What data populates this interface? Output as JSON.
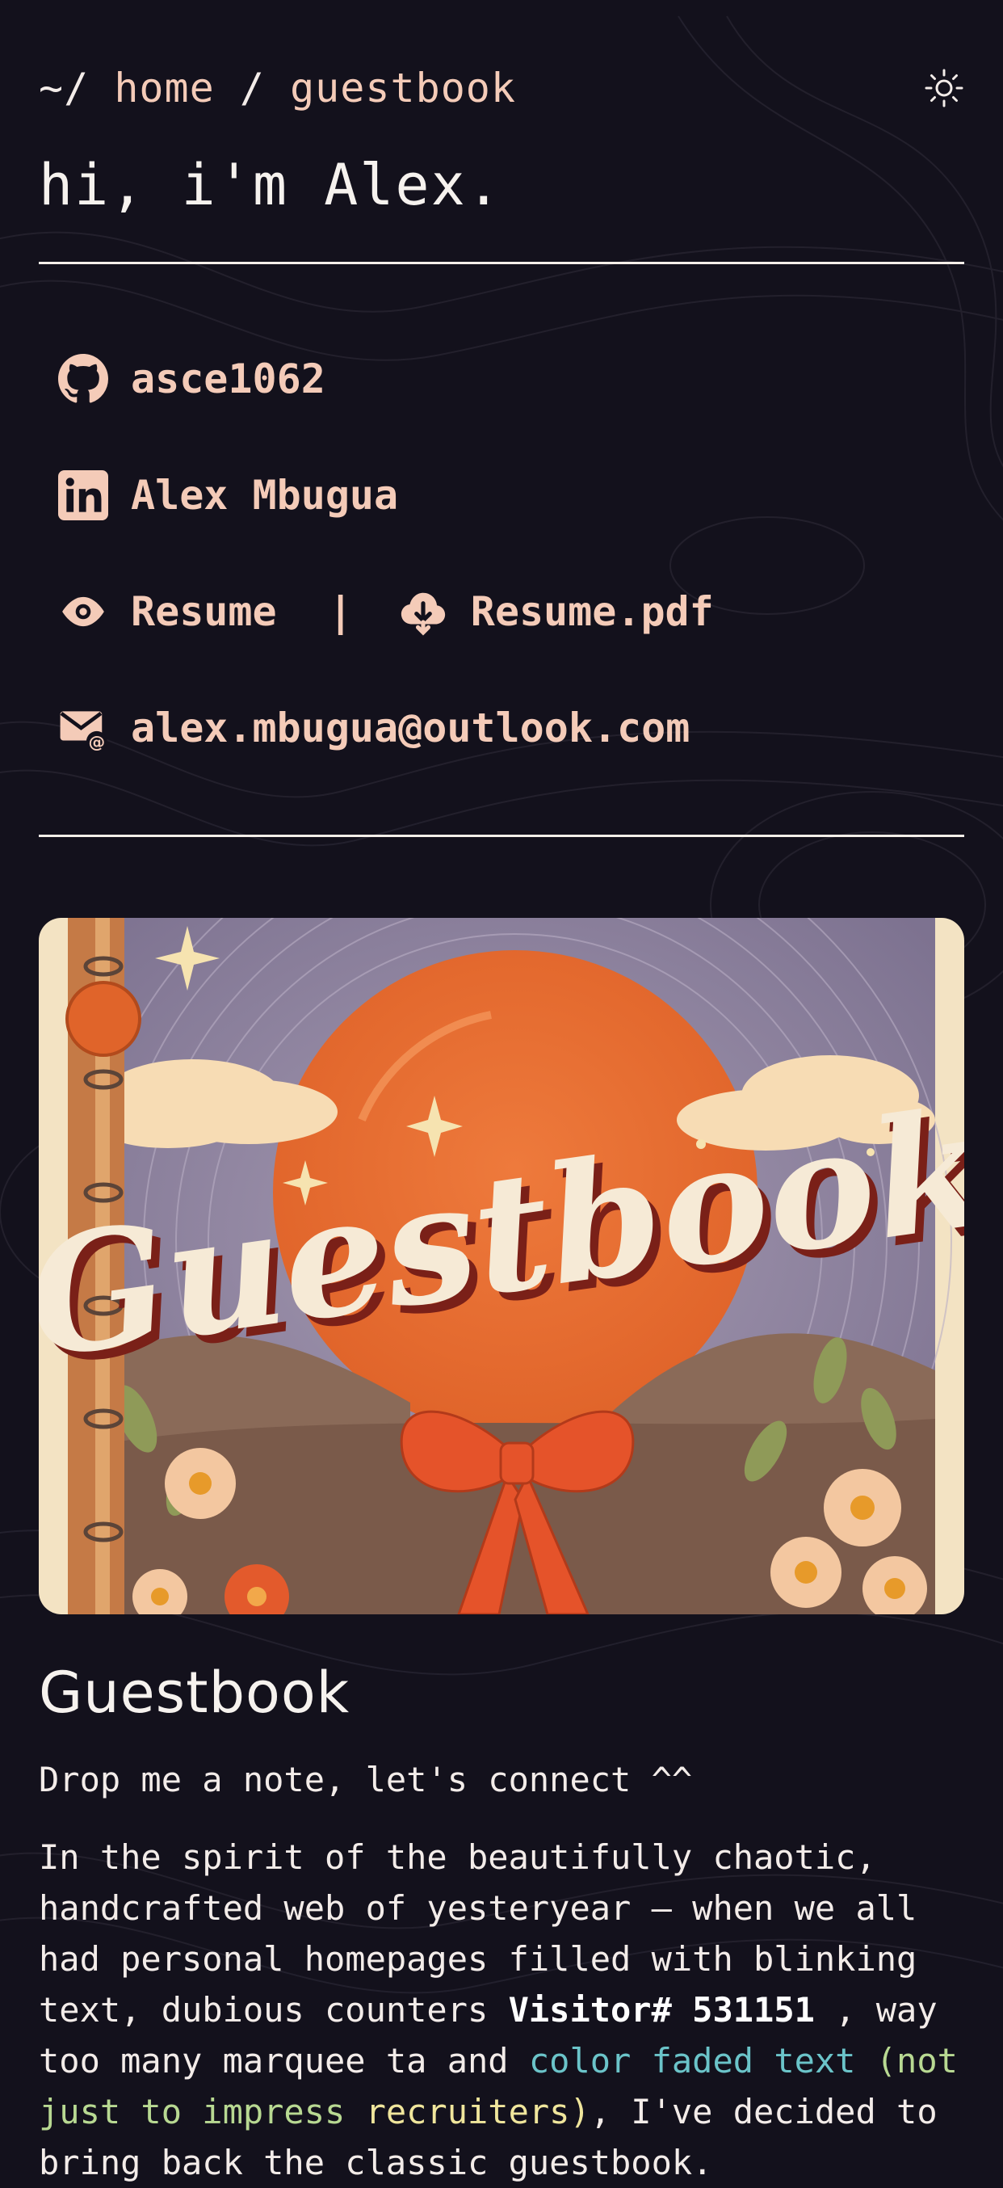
{
  "header": {
    "breadcrumb_root": "~/",
    "breadcrumb_home": "home",
    "breadcrumb_sep": "/",
    "breadcrumb_current": "guestbook",
    "theme_toggle_icon": "sun-icon"
  },
  "hero": {
    "title": "hi, i'm Alex."
  },
  "links": {
    "github": {
      "icon": "github-icon",
      "label": "asce1062"
    },
    "linkedin": {
      "icon": "linkedin-icon",
      "label": "Alex Mbugua"
    },
    "resume": {
      "icon": "eye-icon",
      "label": "Resume"
    },
    "separator": "|",
    "resume_pdf": {
      "icon": "cloud-download-icon",
      "label": "Resume.pdf"
    },
    "email": {
      "icon": "mail-icon",
      "label": "alex.mbugua@outlook.com"
    }
  },
  "banner": {
    "text": "Guestbook"
  },
  "guestbook": {
    "title": "Guestbook",
    "tagline": "Drop me a note, let's connect ^^",
    "para_1": "In the spirit of the beautifully chaotic, handcrafted web of yesteryear — when we all had personal homepages filled with blinking text, dubious counters",
    "counter": "Visitor# 531151",
    "para_2": " , way too many ",
    "marquee": "marquee ta",
    "para_3": " and ",
    "faded_1": "color faded text",
    "faded_2": " (not just to impress ",
    "faded_3": "recruiters)",
    "para_4": ", I've decided to bring back the classic guestbook."
  },
  "colors": {
    "background": "#13111c",
    "accent": "#f4cbb8",
    "text": "#f3ece9"
  }
}
